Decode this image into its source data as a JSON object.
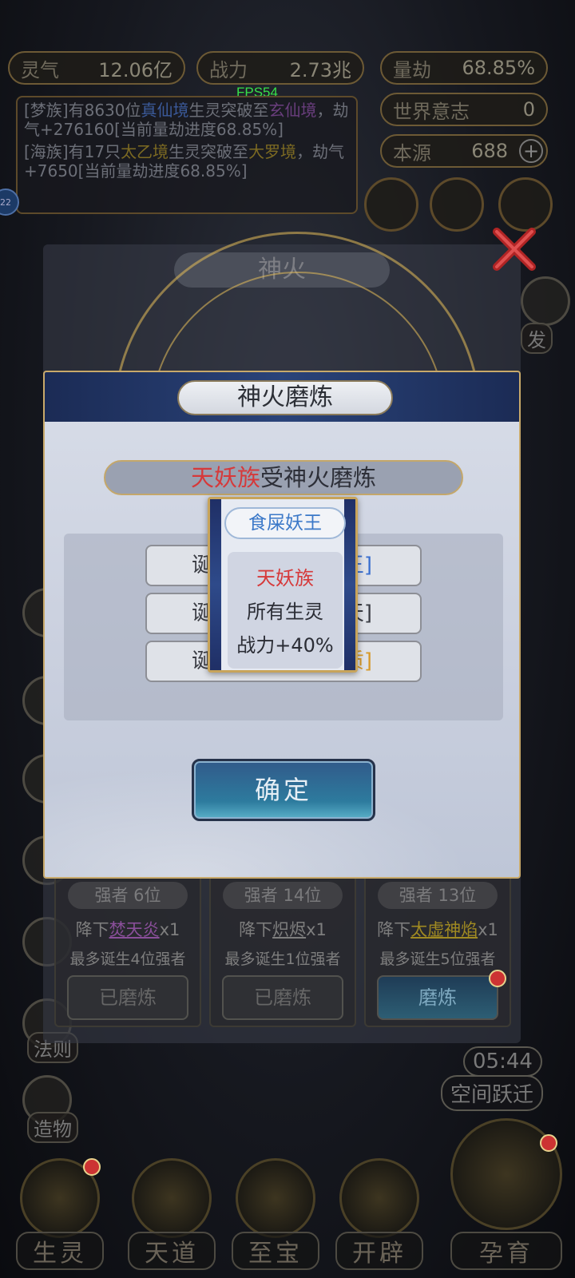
{
  "status": {
    "lingqi_label": "灵气",
    "lingqi_value": "12.06亿",
    "zhanli_label": "战力",
    "zhanli_value": "2.73兆",
    "liangjie_label": "量劫",
    "liangjie_value": "68.85%",
    "shijie_label": "世界意志",
    "shijie_value": "0",
    "benyuan_label": "本源",
    "benyuan_value": "688",
    "fps": "FPS54"
  },
  "log": {
    "msg1_a": "[梦族]有8630位",
    "msg1_b": "真仙境",
    "msg1_c": "生灵突破至",
    "msg1_d": "玄仙境",
    "msg1_e": "，劫气+276160[当前量劫进度68.85%]",
    "msg2_a": "[海族]有17只",
    "msg2_b": "太乙境",
    "msg2_c": "生灵突破至",
    "msg2_d": "大罗境",
    "msg2_e": "，劫气+7650[当前量劫进度68.85%]"
  },
  "side_badge": "22",
  "back_panel_title": "神火",
  "side_right_label": "发",
  "left_labels": {
    "fa_ze": "法则",
    "zao_wu": "造物"
  },
  "space_jump": {
    "timer": "05:44",
    "label": "空间跃迁"
  },
  "cards": [
    {
      "rank": "强者  6位",
      "prefix": "降下",
      "fire": "焚天炎",
      "suffix": "x1",
      "max": "最多诞生4位强者",
      "btn": "已磨炼"
    },
    {
      "rank": "强者  14位",
      "prefix": "降下",
      "fire": "炽烬",
      "suffix": "x1",
      "max": "最多诞生1位强者",
      "btn": "已磨炼"
    },
    {
      "rank": "强者  13位",
      "prefix": "降下",
      "fire": "太虚神焰",
      "suffix": "x1",
      "max": "最多诞生5位强者",
      "btn": "磨炼"
    }
  ],
  "dialog": {
    "title": "神火磨炼",
    "subtitle_tribe": "天妖族",
    "subtitle_rest": "受神火磨炼",
    "rows": [
      {
        "left": "诞",
        "right": "王]"
      },
      {
        "left": "诞",
        "right": "天]"
      },
      {
        "left": "诞",
        "right": "质]"
      }
    ],
    "confirm": "确定"
  },
  "tooltip": {
    "name": "食屎妖王",
    "line1": "天妖族",
    "line2": "所有生灵",
    "line3": "战力+40%"
  },
  "nav": [
    "生灵",
    "天道",
    "至宝",
    "开辟",
    "孕育"
  ]
}
